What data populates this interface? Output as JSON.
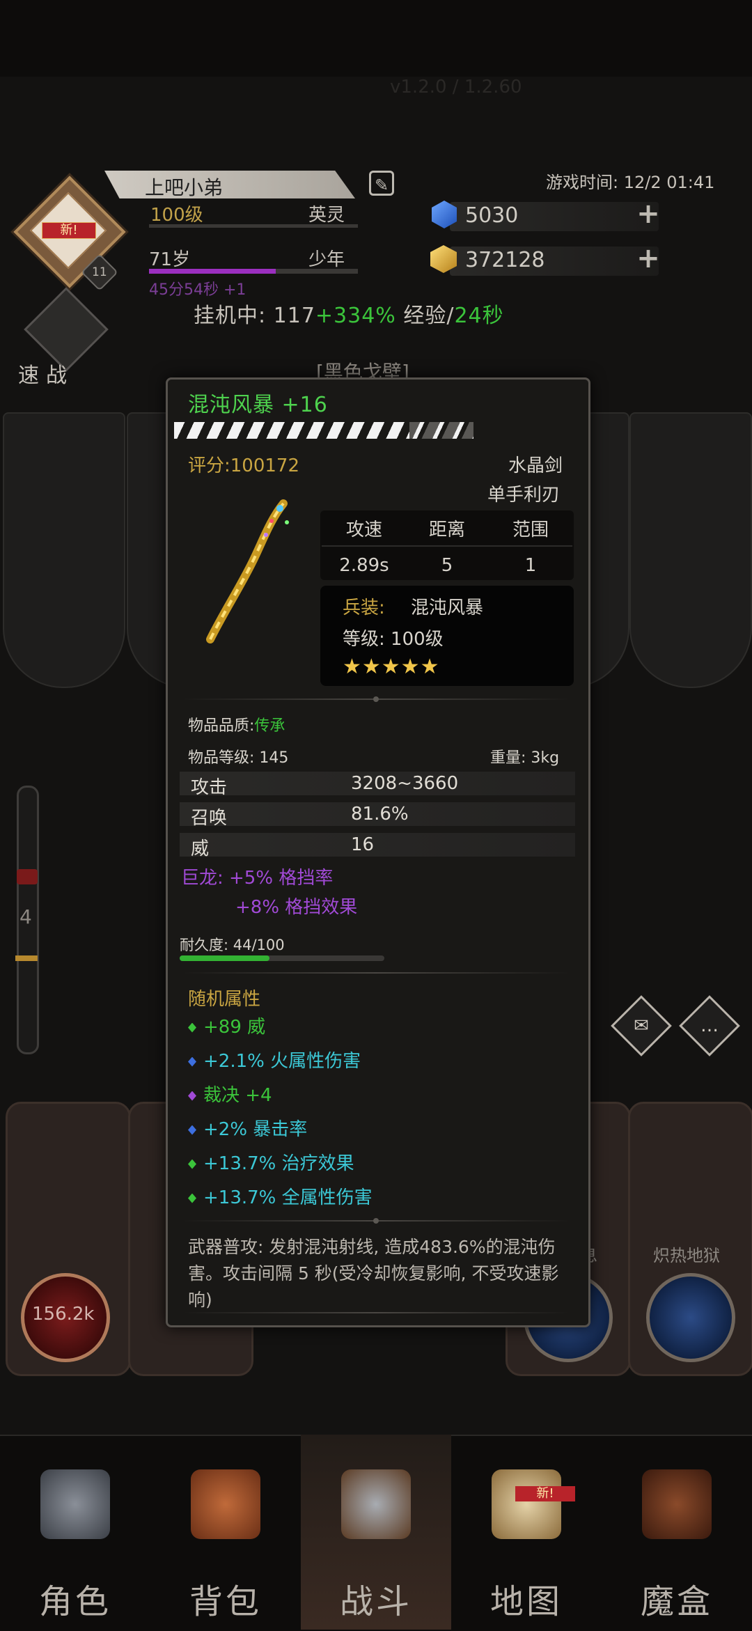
{
  "header": {
    "version_text": "v1.2.0 / 1.2.60",
    "player_name": "上吧小弟",
    "avatar_badge": "新!",
    "avatar_level_badge": "11",
    "level": "100级",
    "rank": "英灵",
    "age": "71岁",
    "age_stage": "少年",
    "age_timer": "45分54秒 +1",
    "game_time": "游戏时间: 12/2 01:41",
    "gems": "5030",
    "gold": "372128",
    "idle_prefix": "挂机中: 117",
    "idle_bonus": "+334%",
    "idle_mid": " 经验/",
    "idle_rate": "24秒",
    "quick_battle": "速战",
    "zone_title": "[黑色戈壁]"
  },
  "side_gauge": {
    "value": "4"
  },
  "bottom_slots": {
    "first_value": "156.2k",
    "slot_name_1": "息",
    "slot_name_2": "炽热地狱"
  },
  "item": {
    "name": "混沌风暴 +16",
    "score": "评分:100172",
    "weapon_type": "水晶剑",
    "weapon_sub": "单手利刃",
    "stats_headers": [
      "攻速",
      "距离",
      "范围"
    ],
    "stats_values": [
      "2.89s",
      "5",
      "1"
    ],
    "soldier_label": "兵装:",
    "soldier_value": "混沌风暴",
    "soldier_level": "等级: 100级",
    "stars": "★★★★★",
    "quality_label": "物品品质:",
    "quality_value": "传承",
    "item_level": "物品等级: 145",
    "weight": "重量: 3kg",
    "attributes": [
      {
        "name": "攻击",
        "value": "3208~3660"
      },
      {
        "name": "召唤",
        "value": "81.6%"
      },
      {
        "name": "威",
        "value": "16"
      }
    ],
    "set_line1": "巨龙: +5% 格挡率",
    "set_line2": "+8% 格挡效果",
    "durability": "耐久度: 44/100",
    "durability_fraction": 0.44,
    "random_title": "随机属性",
    "random_attrs": [
      {
        "text": "+89 威",
        "gem_color": "#3bc43b"
      },
      {
        "text": "+2.1% 火属性伤害",
        "gem_color": "#3d6fe0"
      },
      {
        "text": "裁决 +4",
        "gem_color": "#a14ad6"
      },
      {
        "text": "+2% 暴击率",
        "gem_color": "#3d6fe0"
      },
      {
        "text": "+13.7% 治疗效果",
        "gem_color": "#3bc43b"
      },
      {
        "text": "+13.7% 全属性伤害",
        "gem_color": "#3bc43b"
      }
    ],
    "description": "武器普攻: 发射混沌射线, 造成483.6%的混沌伤害。攻击间隔 5 秒(受冷却恢复影响, 不受攻速影响)"
  },
  "nav": {
    "items": [
      {
        "label": "角色",
        "icon": "helmet-icon"
      },
      {
        "label": "背包",
        "icon": "backpack-icon"
      },
      {
        "label": "战斗",
        "icon": "sword-shield-icon"
      },
      {
        "label": "地图",
        "icon": "scroll-map-icon",
        "badge": "新!"
      },
      {
        "label": "魔盒",
        "icon": "magic-box-icon"
      }
    ],
    "active_index": 2
  },
  "colors": {
    "legendary_green": "#3bc43b",
    "score_gold": "#c9a542",
    "set_purple": "#a14ad6",
    "bg": "#131211"
  }
}
